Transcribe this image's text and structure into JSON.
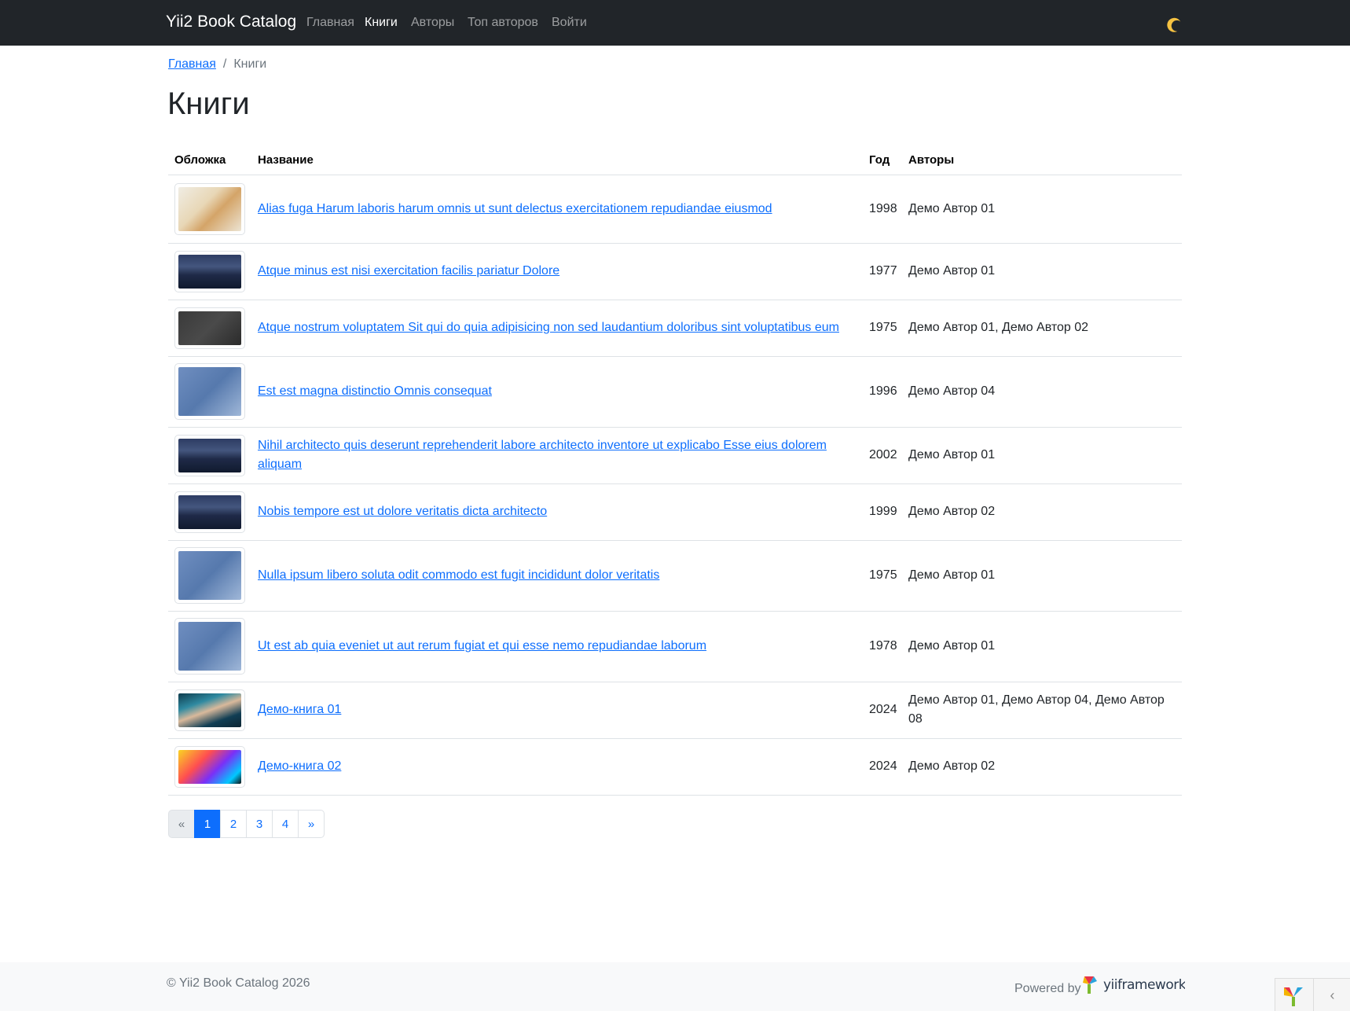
{
  "navbar": {
    "brand": "Yii2 Book Catalog",
    "links": [
      {
        "label": "Главная",
        "active": false
      },
      {
        "label": "Книги",
        "active": true
      },
      {
        "label": "Авторы",
        "active": false
      },
      {
        "label": "Топ авторов",
        "active": false
      },
      {
        "label": "Войти",
        "active": false
      }
    ],
    "theme_icon": "moon-icon"
  },
  "breadcrumb": {
    "home": "Главная",
    "separator": "/",
    "current": "Книги"
  },
  "page_title": "Книги",
  "table": {
    "headers": {
      "cover": "Обложка",
      "title": "Название",
      "year": "Год",
      "authors": "Авторы"
    },
    "rows": [
      {
        "cover": "cat-image",
        "title": "Alias fuga Harum laboris harum omnis ut sunt delectus exercitationem repudiandae eiusmod",
        "year": "1998",
        "authors": "Демо Автор 01"
      },
      {
        "cover": "dune-image",
        "title": "Atque minus est nisi exercitation facilis pariatur Dolore",
        "year": "1977",
        "authors": "Демо Автор 01"
      },
      {
        "cover": "dark-image",
        "title": "Atque nostrum voluptatem Sit qui do quia adipisicing non sed laudantium doloribus sint voluptatibus eum",
        "year": "1975",
        "authors": "Демо Автор 01, Демо Автор 02"
      },
      {
        "cover": "map-image",
        "title": "Est est magna distinctio Omnis consequat",
        "year": "1996",
        "authors": "Демо Автор 04"
      },
      {
        "cover": "dune-image",
        "title": "Nihil architecto quis deserunt reprehenderit labore architecto inventore ut explicabo Esse eius dolorem aliquam",
        "year": "2002",
        "authors": "Демо Автор 01"
      },
      {
        "cover": "dune-image",
        "title": "Nobis tempore est ut dolore veritatis dicta architecto",
        "year": "1999",
        "authors": "Демо Автор 02"
      },
      {
        "cover": "map-image",
        "title": "Nulla ipsum libero soluta odit commodo est fugit incididunt dolor veritatis",
        "year": "1975",
        "authors": "Демо Автор 01"
      },
      {
        "cover": "map-image",
        "title": "Ut est ab quia eveniet ut aut rerum fugiat et qui esse nemo repudiandae laborum",
        "year": "1978",
        "authors": "Демо Автор 01"
      },
      {
        "cover": "wave-image",
        "title": "Демо-книга 01",
        "year": "2024",
        "authors": "Демо Автор 01, Демо Автор 04, Демо Автор 08"
      },
      {
        "cover": "color-swirl-image",
        "title": "Демо-книга 02",
        "year": "2024",
        "authors": "Демо Автор 02"
      }
    ]
  },
  "pagination": {
    "prev": "«",
    "pages": [
      "1",
      "2",
      "3",
      "4"
    ],
    "active_page": "1",
    "next": "»"
  },
  "footer": {
    "copyright": "© Yii2 Book Catalog 2026",
    "powered_by": "Powered by",
    "framework_logo_text": "yiiframework"
  },
  "debug": {
    "toggle": "‹"
  },
  "colors": {
    "navbar_bg": "#212529",
    "link": "#0d6efd",
    "active_page": "#0d6efd",
    "footer_bg": "#f8f9fa"
  }
}
